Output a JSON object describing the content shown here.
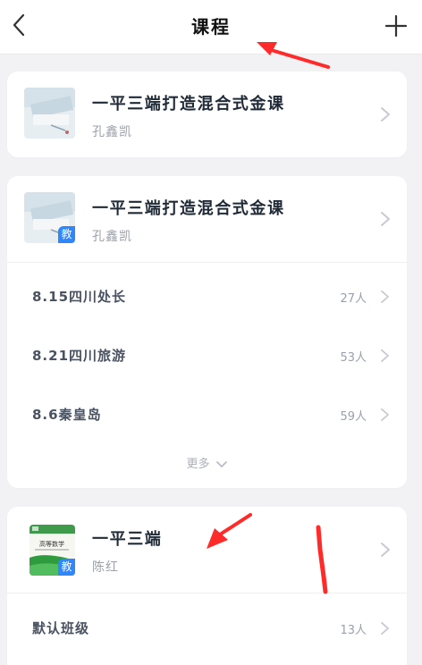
{
  "header": {
    "title": "课程"
  },
  "courses": [
    {
      "title": "一平三端打造混合式金课",
      "teacher": "孔鑫凯",
      "badge": ""
    },
    {
      "title": "一平三端打造混合式金课",
      "teacher": "孔鑫凯",
      "badge": "教",
      "classes": [
        {
          "name": "8.15四川处长",
          "count": "27人"
        },
        {
          "name": "8.21四川旅游",
          "count": "53人"
        },
        {
          "name": "8.6秦皇岛",
          "count": "59人"
        }
      ],
      "more_label": "更多"
    },
    {
      "title": "一平三端",
      "teacher": "陈红",
      "badge": "教",
      "classes": [
        {
          "name": "默认班级",
          "count": "13人"
        }
      ]
    }
  ],
  "icons": {
    "back": "back-chevron-icon",
    "add": "plus-icon",
    "row_chevron": "chevron-right-icon",
    "more_chevron": "chevron-down-icon"
  },
  "colors": {
    "annotation": "#ff2a2a",
    "badge": "#2f87ff",
    "text_primary": "#1f2a36",
    "text_secondary": "#9aa1aa"
  }
}
